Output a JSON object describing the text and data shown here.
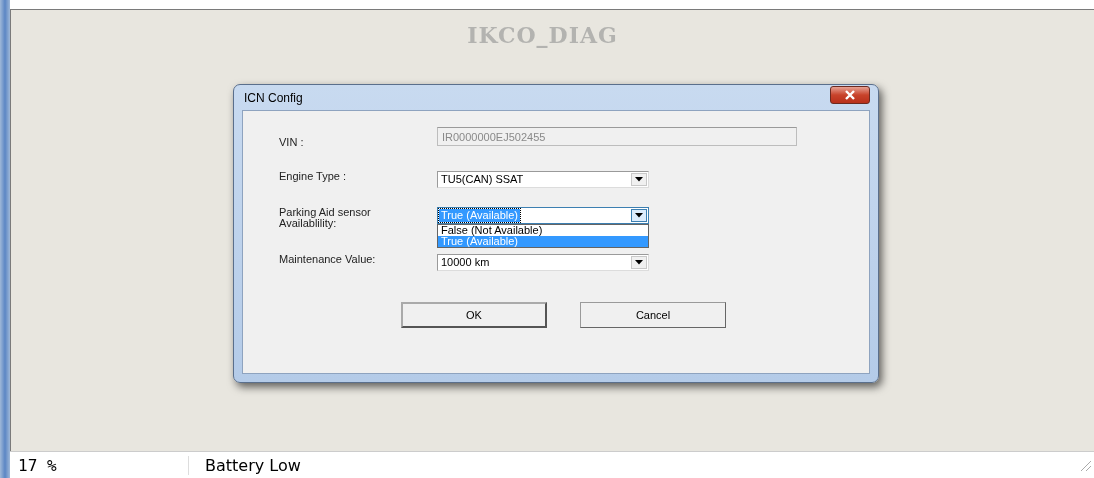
{
  "app_title": "IKCO_DIAG",
  "dialog": {
    "title": "ICN Config",
    "fields": [
      {
        "kind": "text",
        "label": "VIN :",
        "value": "IR0000000EJ502455",
        "disabled": true
      },
      {
        "kind": "combo",
        "label": "Engine Type :",
        "value": "TU5(CAN) SSAT",
        "focused": false
      },
      {
        "kind": "combo",
        "label": "Parking Aid sensor\nAvailablility:",
        "value": "True (Available)",
        "focused": true,
        "expanded": true,
        "options": [
          {
            "label": "False (Not Available)",
            "selected": false
          },
          {
            "label": "True (Available)",
            "selected": true
          }
        ]
      },
      {
        "kind": "combo",
        "label": "Maintenance Value:",
        "value": "10000 km",
        "focused": false
      }
    ],
    "buttons": [
      {
        "label": "OK",
        "default": true
      },
      {
        "label": "Cancel",
        "default": false
      }
    ]
  },
  "status_bar": {
    "battery": "17 %",
    "message": "Battery Low"
  }
}
